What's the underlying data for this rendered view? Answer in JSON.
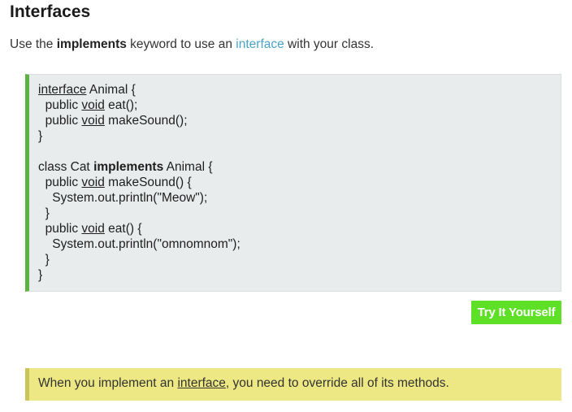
{
  "heading": "Interfaces",
  "intro": {
    "part1": "Use the ",
    "keyword": "implements",
    "part2": " keyword to use an ",
    "link": "interface",
    "part3": " with your class."
  },
  "code": {
    "l1_kw": "interface",
    "l1_rest": " Animal {",
    "l2_pre": "  public ",
    "l2_kw": "void",
    "l2_rest": " eat();",
    "l3_pre": "  public ",
    "l3_kw": "void",
    "l3_rest": " makeSound();",
    "l4": "}",
    "l6_pre": "class Cat ",
    "l6_kw": "implements",
    "l6_rest": " Animal {",
    "l7_pre": "  public ",
    "l7_kw": "void",
    "l7_rest": " makeSound() {",
    "l8": "    System.out.println(\"Meow\");",
    "l9": "  }",
    "l10_pre": "  public ",
    "l10_kw": "void",
    "l10_rest": " eat() {",
    "l11": "    System.out.println(\"omnomnom\");",
    "l12": "  }",
    "l13": "}"
  },
  "try_button_label": "Try It Yourself",
  "note": {
    "part1": "When you implement an ",
    "link": "interface",
    "part2": ", you need to override all of its methods."
  },
  "colors": {
    "code_accent": "#5cb344",
    "button_bg": "#5ee027",
    "note_bg": "#ede883",
    "note_accent": "#cbc45b",
    "link": "#4aa3c7"
  }
}
